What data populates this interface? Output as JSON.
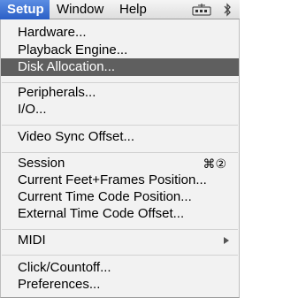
{
  "menubar": {
    "items": [
      {
        "label": "Setup",
        "active": true
      },
      {
        "label": "Window",
        "active": false
      },
      {
        "label": "Help",
        "active": false
      }
    ],
    "status_icons": [
      "midi-interface-icon",
      "bluetooth-icon"
    ]
  },
  "menu": {
    "title": "Setup",
    "highlighted": "Disk Allocation...",
    "items": [
      {
        "label": "Hardware..."
      },
      {
        "label": "Playback Engine..."
      },
      {
        "label": "Disk Allocation..."
      },
      {
        "label": "Peripherals..."
      },
      {
        "label": "I/O..."
      },
      {
        "label": "Video Sync Offset..."
      },
      {
        "label": "Session",
        "shortcut": "⌘②"
      },
      {
        "label": "Current Feet+Frames Position..."
      },
      {
        "label": "Current Time Code Position..."
      },
      {
        "label": "External Time Code Offset..."
      },
      {
        "label": "MIDI",
        "submenu": true
      },
      {
        "label": "Click/Countoff..."
      },
      {
        "label": "Preferences..."
      }
    ]
  },
  "colors": {
    "menubar_active": "#2a5fc6",
    "item_highlight": "#5f5f5f",
    "menu_background": "#f2f2f2"
  }
}
